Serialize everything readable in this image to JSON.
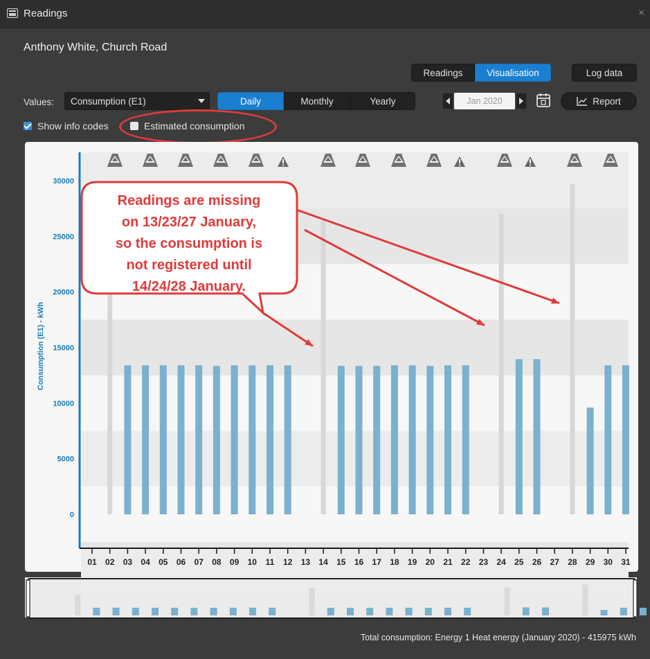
{
  "window": {
    "title": "Readings"
  },
  "customer": "Anthony White, Church Road",
  "view_tabs": [
    {
      "label": "Readings",
      "active": false
    },
    {
      "label": "Visualisation",
      "active": true
    }
  ],
  "log_data_label": "Log data",
  "values_label": "Values:",
  "values_select": "Consumption (E1)",
  "period_tabs": [
    {
      "label": "Daily",
      "active": true
    },
    {
      "label": "Monthly",
      "active": false
    },
    {
      "label": "Yearly",
      "active": false
    }
  ],
  "month_field": "Jan 2020",
  "report_label": "Report",
  "show_info_codes": {
    "label": "Show info codes",
    "checked": true
  },
  "estimated_consumption": {
    "label": "Estimated consumption",
    "checked": false
  },
  "annotation": "Readings are missing on 13/23/27 January, so the consumption is not registered until 14/24/28 January.",
  "annotation_lines": [
    "Readings are missing",
    "on 13/23/27 January,",
    "so the consumption is",
    "not registered until",
    "14/24/28 January."
  ],
  "chart_data": {
    "type": "bar",
    "ylabel": "Consumption (E1) - kWh",
    "ylim": [
      -3000,
      32000
    ],
    "yticks": [
      0,
      5000,
      10000,
      15000,
      20000,
      25000,
      30000
    ],
    "categories": [
      "01",
      "02",
      "03",
      "04",
      "05",
      "06",
      "07",
      "08",
      "09",
      "10",
      "11",
      "12",
      "13",
      "14",
      "15",
      "16",
      "17",
      "18",
      "19",
      "20",
      "21",
      "22",
      "23",
      "24",
      "25",
      "26",
      "27",
      "28",
      "29",
      "30",
      "31"
    ],
    "series": [
      {
        "values": [
          null,
          null,
          13400,
          13400,
          13400,
          13400,
          13400,
          13350,
          13400,
          13400,
          13400,
          13400,
          null,
          null,
          13350,
          13350,
          13350,
          13400,
          13400,
          13350,
          13400,
          13400,
          null,
          null,
          13950,
          13950,
          null,
          null,
          9600,
          13400,
          13400
        ]
      }
    ],
    "background_bars": {
      "02": 20000,
      "14": 26500,
      "24": 27000,
      "28": 29700
    },
    "info_codes": [
      "01",
      "02",
      "03",
      "04",
      "05",
      "06",
      "07",
      "08",
      "09",
      "10",
      "11",
      "12",
      "13",
      "14",
      "15",
      "16",
      "17",
      "18",
      "19",
      "20",
      "21",
      "22",
      "23",
      "24",
      "25",
      "26",
      "27",
      "28",
      "29",
      "30",
      "31"
    ],
    "warnings": [
      "05",
      "14",
      "22",
      "26"
    ],
    "color_bar": "#7ab1ce",
    "color_missing": "#d7d7d7",
    "color_axis": "#1a7bb8"
  },
  "footer": "Total consumption: Energy 1 Heat energy (January 2020) - 415975 kWh"
}
